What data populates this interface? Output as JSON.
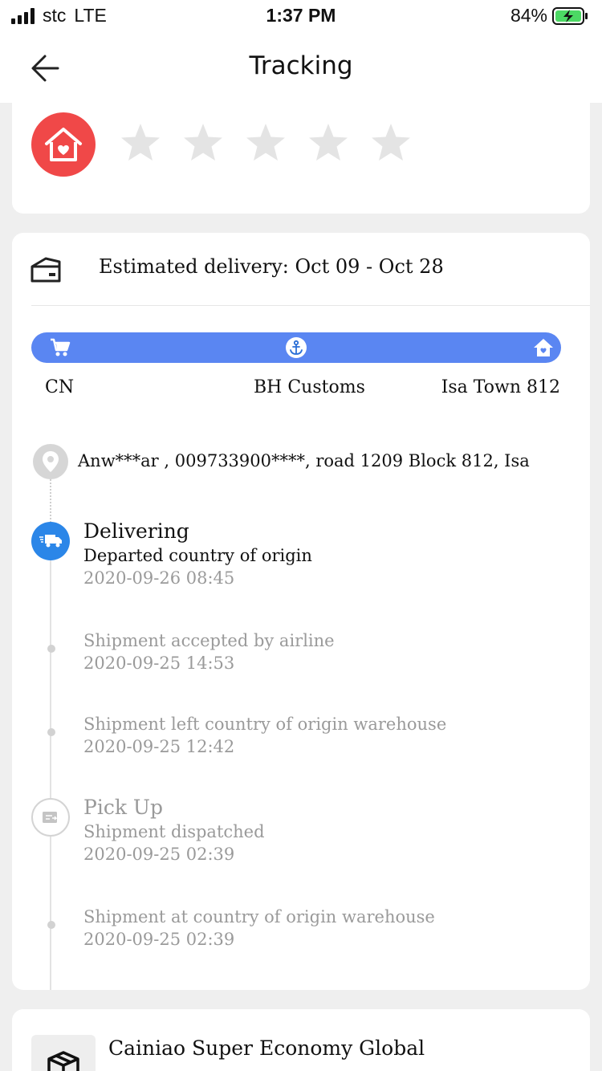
{
  "status_bar": {
    "carrier": "stc",
    "network": "LTE",
    "time": "1:37 PM",
    "battery": "84%",
    "battery_level": 0.84
  },
  "header": {
    "title": "Tracking"
  },
  "rating": {
    "stars_total": 5,
    "stars_filled": 0,
    "icon": "home-heart-icon",
    "icon_color": "#f04848"
  },
  "delivery": {
    "estimated_text": "Estimated delivery: Oct 09 - Oct 28"
  },
  "route": {
    "bar_color": "#5a86f2",
    "stops": [
      {
        "label": "CN",
        "icon": "cart-icon"
      },
      {
        "label": "BH Customs",
        "icon": "anchor-icon"
      },
      {
        "label": "Isa Town 812",
        "icon": "home-icon"
      }
    ]
  },
  "address": {
    "text": "Anw***ar ,  009733900****,  road 1209 Block 812,  Isa"
  },
  "events": [
    {
      "title": "Delivering",
      "desc": "Departed country of origin",
      "time": "2020-09-26 08:45"
    },
    {
      "desc": "Shipment accepted by airline",
      "time": "2020-09-25 14:53"
    },
    {
      "desc": "Shipment left country of origin warehouse",
      "time": "2020-09-25 12:42"
    },
    {
      "title": "Pick Up",
      "desc": "Shipment dispatched",
      "time": "2020-09-25 02:39"
    },
    {
      "desc": "Shipment at country of origin warehouse",
      "time": "2020-09-25 02:39"
    }
  ],
  "carrier": {
    "name": "Cainiao Super Economy Global"
  },
  "colors": {
    "active_node": "#2b86e8",
    "muted_text": "#9a9a9a"
  }
}
